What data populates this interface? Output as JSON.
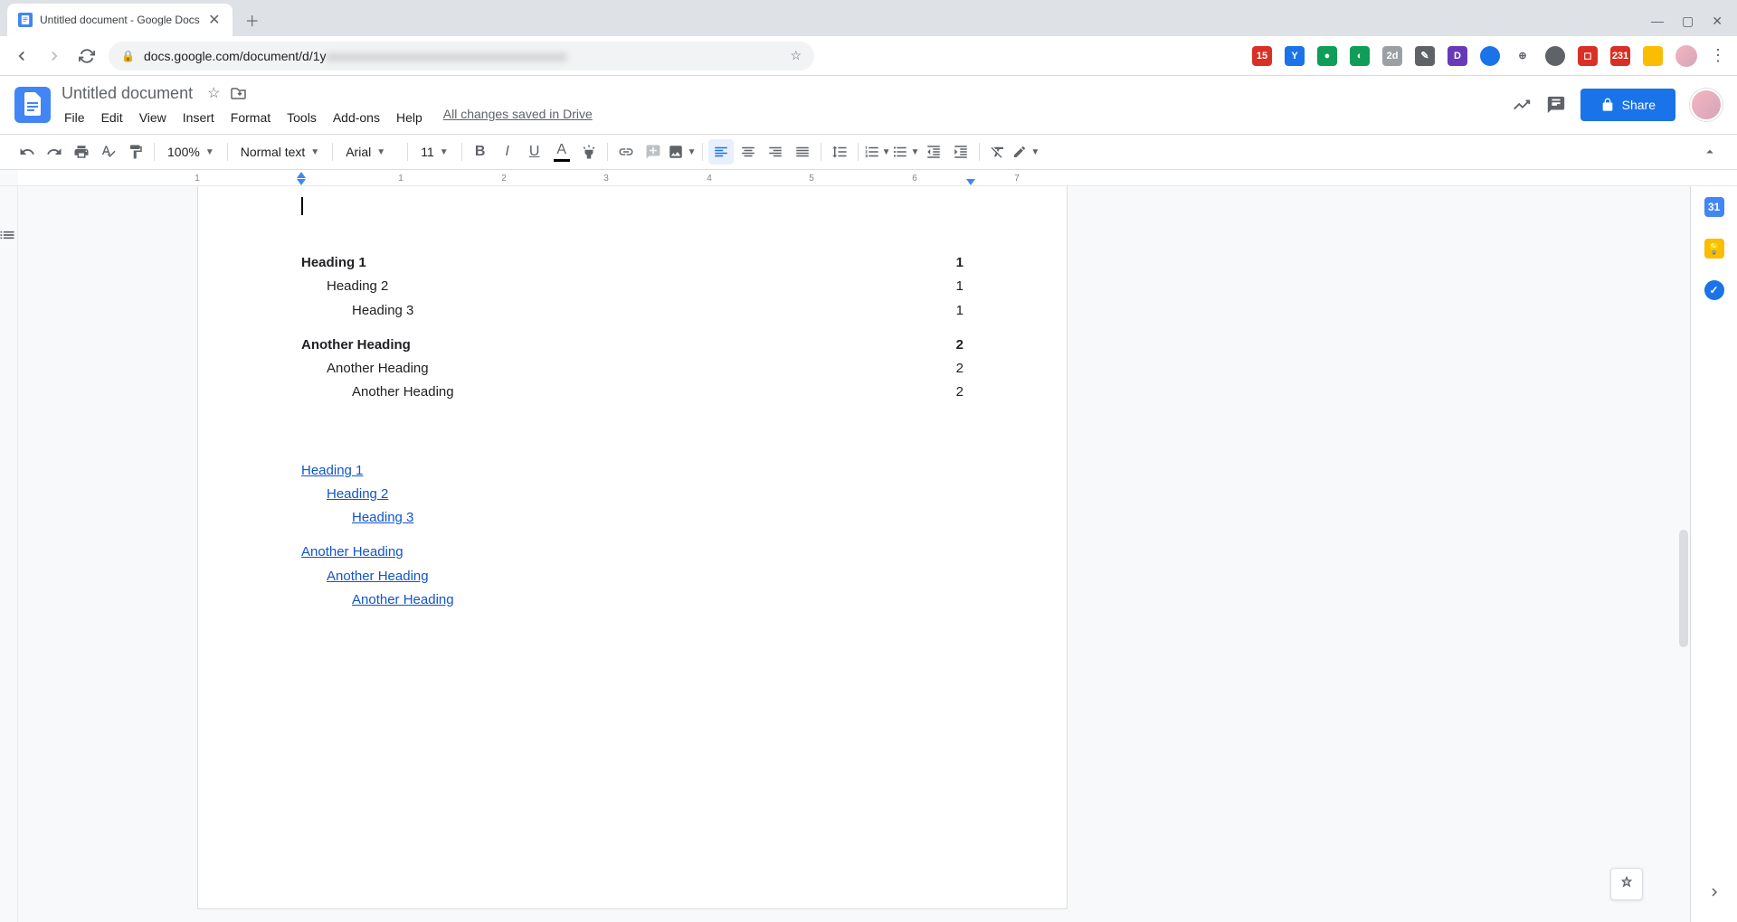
{
  "browser": {
    "tab_title": "Untitled document - Google Docs",
    "url_prefix": "docs.google.com/document/d/1y",
    "url_blurred": "xxxxxxxxxxxxxxxxxxxxxxxxxxxxxxxxxxxxxx"
  },
  "header": {
    "doc_title": "Untitled document",
    "menus": [
      "File",
      "Edit",
      "View",
      "Insert",
      "Format",
      "Tools",
      "Add-ons",
      "Help"
    ],
    "save_status": "All changes saved in Drive",
    "share_label": "Share"
  },
  "toolbar": {
    "zoom": "100%",
    "style": "Normal text",
    "font": "Arial",
    "size": "11"
  },
  "ruler": {
    "markers": [
      "1",
      "1",
      "2",
      "3",
      "4",
      "5",
      "6",
      "7"
    ]
  },
  "toc_numbered": [
    {
      "level": 1,
      "text": "Heading 1",
      "page": "1"
    },
    {
      "level": 2,
      "text": "Heading 2",
      "page": "1"
    },
    {
      "level": 3,
      "text": "Heading 3",
      "page": "1"
    },
    {
      "level": 1,
      "text": "Another Heading",
      "page": "2",
      "gap": true
    },
    {
      "level": 2,
      "text": "Another Heading",
      "page": "2"
    },
    {
      "level": 3,
      "text": "Another Heading",
      "page": "2"
    }
  ],
  "toc_links": [
    {
      "level": 1,
      "text": "Heading 1"
    },
    {
      "level": 2,
      "text": "Heading 2"
    },
    {
      "level": 3,
      "text": "Heading 3"
    },
    {
      "level": 1,
      "text": "Another Heading",
      "gap": true
    },
    {
      "level": 2,
      "text": "Another Heading"
    },
    {
      "level": 3,
      "text": "Another Heading"
    }
  ]
}
